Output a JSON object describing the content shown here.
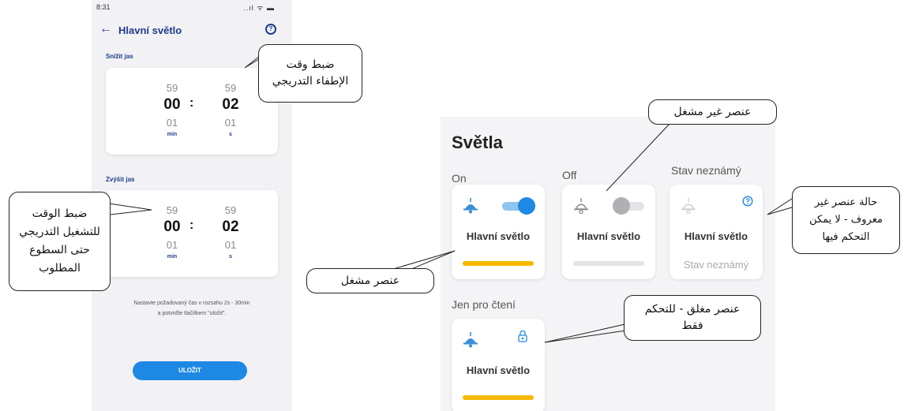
{
  "phone": {
    "status": {
      "time": "8:31",
      "icons": "..ıl ᯤ ▬"
    },
    "appbar": {
      "back_glyph": "←",
      "title": "Hlavní světlo",
      "help_glyph": "?"
    },
    "dim": {
      "label": "Snížit jas",
      "minutes": {
        "above": "59",
        "value": "00",
        "below": "01",
        "unit": "min"
      },
      "separator": ":",
      "seconds": {
        "above": "59",
        "value": "02",
        "below": "01",
        "unit": "s"
      }
    },
    "brighten": {
      "label": "Zvýšit jas",
      "minutes": {
        "above": "59",
        "value": "00",
        "below": "01",
        "unit": "min"
      },
      "separator": ":",
      "seconds": {
        "above": "59",
        "value": "02",
        "below": "01",
        "unit": "s"
      }
    },
    "hint_line1": "Nastavte požadovaný čas v rozsahu 2s - 30min",
    "hint_line2": "a potvrďte tlačítkem \"uložit\".",
    "save_label": "ULOŽIT"
  },
  "lights": {
    "title": "Světla",
    "groups": {
      "on": "On",
      "off": "Off",
      "unknown": "Stav neznámý",
      "readonly": "Jen pro čtení"
    },
    "cards": {
      "on": {
        "name": "Hlavní světlo",
        "toggle": "on"
      },
      "off": {
        "name": "Hlavní světlo",
        "toggle": "off"
      },
      "unknown": {
        "name": "Hlavní světlo",
        "state": "Stav neznámý",
        "icon": "help-icon"
      },
      "readonly": {
        "name": "Hlavní světlo",
        "icon": "lock-icon"
      }
    }
  },
  "callouts": {
    "dim_time": [
      "ضبط وقت",
      "الإطفاء التدريجي"
    ],
    "brighten_time": [
      "ضبط الوقت",
      "للتشغيل التدريجي",
      "حتى السطوع",
      "المطلوب"
    ],
    "inactive": "عنصر غير مشغل",
    "active": "عنصر مشغل",
    "unknown_state": [
      "حالة عنصر غير",
      "معروف - لا يمكن",
      "التحكم فيها"
    ],
    "locked": [
      "عنصر مغلق - للتحكم",
      "فقط"
    ]
  },
  "colors": {
    "accent_blue": "#1e88e5",
    "title_blue": "#1e3a8a",
    "lamp_blue": "#3a8fd6",
    "on_bar": "#f5b800",
    "off_bar": "#e4e4e8",
    "off_toggle": "#b0b0b4"
  }
}
